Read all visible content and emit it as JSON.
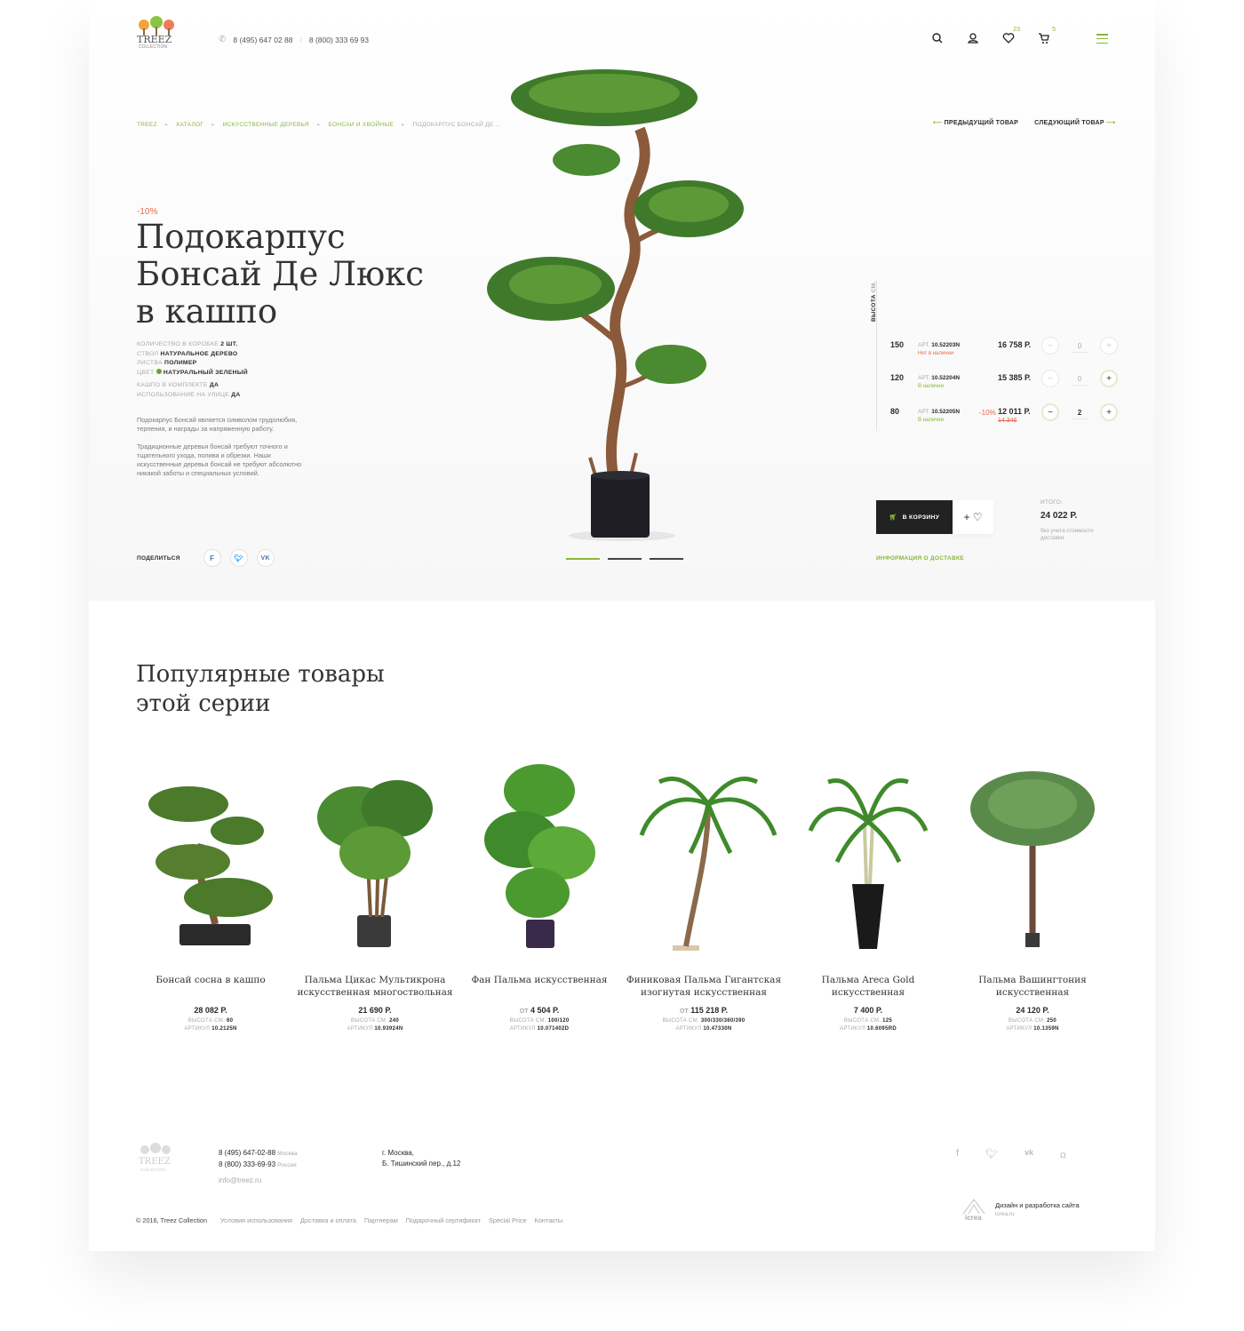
{
  "brand": {
    "name": "TREEZ",
    "sub": "COLLECTION"
  },
  "header": {
    "phone1": "8 (495) 647 02 88",
    "phone2": "8 (800) 333 69 93",
    "favorites_count": "23",
    "cart_count": "5"
  },
  "breadcrumbs": [
    "TREEZ",
    "КАТАЛОГ",
    "ИСКУССТВЕННЫЕ ДЕРЕВЬЯ",
    "БОНСАИ И ХВОЙНЫЕ",
    "ПОДОКАРПУС БОНСАЙ ДЕ ..."
  ],
  "nav": {
    "prev": "ПРЕДЫДУЩИЙ ТОВАР",
    "next": "СЛЕДУЮЩИЙ ТОВАР"
  },
  "product": {
    "discount": "-10%",
    "title_l1": "Подокарпус",
    "title_l2": "Бонсай Де Люкс",
    "title_l3": "в кашпо",
    "props": [
      {
        "k": "КОЛИЧЕСТВО В КОРОБКЕ",
        "v": "2 ШТ."
      },
      {
        "k": "СТВОЛ",
        "v": "НАТУРАЛЬНОЕ ДЕРЕВО"
      },
      {
        "k": "ЛИСТВА",
        "v": "ПОЛИМЕР"
      },
      {
        "k": "ЦВЕТ",
        "v": "НАТУРАЛЬНЫЙ ЗЕЛЕНЫЙ"
      },
      {
        "k": "КАШПО В КОМПЛЕКТЕ",
        "v": "ДА"
      },
      {
        "k": "ИСПОЛЬЗОВАНИЕ НА УЛИЦЕ",
        "v": "ДА"
      }
    ],
    "color_swatch": "#6aa428",
    "desc1": "Подокарпус Бонсай является символом трудолюбия, терпения, и награды за напряженную работу.",
    "desc2": "Традиционные деревья бонсай требуют точного и тщательного ухода, полива и обрезки. Наши искусственные деревья бонсай не требуют абсолютно никакой заботы и специальных условий.",
    "share": "ПОДЕЛИТЬСЯ"
  },
  "variants": {
    "height_label": "ВЫСОТА",
    "height_unit": "СМ.",
    "art_prefix": "АРТ.",
    "rows": [
      {
        "h": "150",
        "art": "10.52203N",
        "status": "Нет в наличии",
        "available": false,
        "disc": "",
        "price": "16 758 Р.",
        "old": "",
        "qty": "0"
      },
      {
        "h": "120",
        "art": "10.52204N",
        "status": "В наличии",
        "available": true,
        "disc": "",
        "price": "15 385 Р.",
        "old": "",
        "qty": "0"
      },
      {
        "h": "80",
        "art": "10.52205N",
        "status": "В наличии",
        "available": true,
        "disc": "-10%",
        "price": "12 011 Р.",
        "old": "14 346",
        "qty": "2"
      }
    ]
  },
  "buy": {
    "cart_label": "В КОРЗИНУ",
    "wish_label": "+ ♡",
    "total_label": "ИТОГО:",
    "total": "24 022 Р.",
    "total_note": "без учета стоимости доставки",
    "delivery": "ИНФОРМАЦИЯ О ДОСТАВКЕ"
  },
  "popular": {
    "title_l1": "Популярные товары",
    "title_l2": "этой серии",
    "items": [
      {
        "name": "Бонсай сосна в кашпо",
        "from": "",
        "price": "28 082 Р.",
        "height": "60",
        "art": "10.2125N"
      },
      {
        "name": "Пальма Цикас Мультикрона искусственная многоствольная",
        "from": "",
        "price": "21 690 Р.",
        "height": "240",
        "art": "10.93924N"
      },
      {
        "name": "Фан Пальма искусственная",
        "from": "ОТ",
        "price": "4 504 Р.",
        "height": "100/120",
        "art": "10.071402D"
      },
      {
        "name": "Финиковая Пальма Гигантская изогнутая искусственная",
        "from": "ОТ",
        "price": "115 218 Р.",
        "height": "300/330/360/390",
        "art": "10.47330N"
      },
      {
        "name": "Пальма Areca Gold искусственная",
        "from": "",
        "price": "7 400 Р.",
        "height": "125",
        "art": "10.6095RD"
      },
      {
        "name": "Пальма Вашингтония искусственная",
        "from": "",
        "price": "24 120 Р.",
        "height": "250",
        "art": "10.1359N"
      }
    ],
    "height_label": "ВЫСОТА СМ.",
    "art_label": "АРТИКУЛ"
  },
  "footer": {
    "phone1": "8 (495) 647-02-88",
    "city1": "Москва",
    "phone2": "8 (800) 333-69-93",
    "city2": "Россия",
    "email": "info@treez.ru",
    "addr1": "г. Москва,",
    "addr2": "Б. Тишинский пер., д.12",
    "copyright": "© 2016, Treez Collection",
    "links": [
      "Условия использования",
      "Доставка и оплата",
      "Партнерам",
      "Подарочный сертификат",
      "Special Price",
      "Контакты"
    ],
    "dev": "Дизайн и разработка сайта",
    "dev_site": "icrea.ru",
    "dev_logo": "icrea"
  },
  "colors": {
    "accent": "#8cb63c",
    "sale": "#e86a4a",
    "dark": "#222222"
  }
}
